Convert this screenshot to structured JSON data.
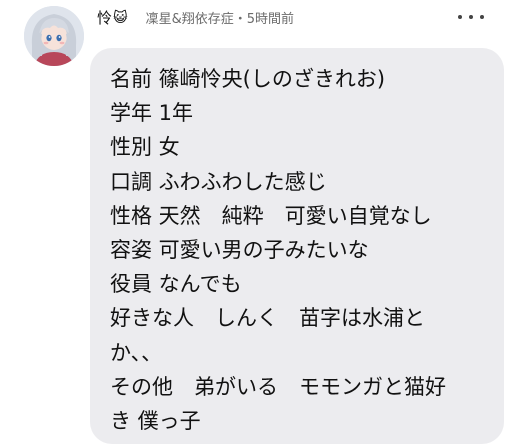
{
  "post": {
    "author": "怜",
    "author_emoji": "😺",
    "subtitle": "凜星&翔依存症・5時間前",
    "more_icon": "more-icon",
    "message": "名前 篠崎怜央(しのざきれお)\n学年 1年\n性別 女\n口調 ふわふわした感じ\n性格 天然　純粋　可愛い自覚なし\n容姿 可愛い男の子みたいな\n役員 なんでも\n好きな人　しんく　苗字は水浦と\nか、、\nその他　弟がいる　モモンガと猫好\nき 僕っ子"
  },
  "colors": {
    "bubble": "#ececef",
    "subtitle": "#6b6b6b"
  }
}
